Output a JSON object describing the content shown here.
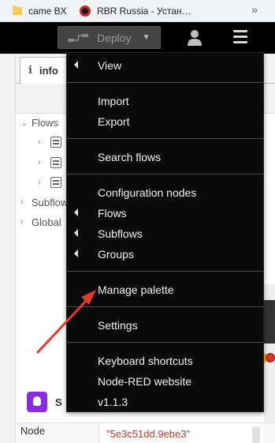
{
  "bookmarks": [
    {
      "label": "came BX",
      "icon": "folder-icon"
    },
    {
      "label": "RBR Russia - Устан…",
      "icon": "rbr-favicon-icon"
    }
  ],
  "bookmarks_more": "»",
  "header": {
    "deploy_label": "Deploy",
    "deploy_caret": "▼"
  },
  "sidebar": {
    "tab_icon": "i",
    "tab_label": "info",
    "tree": {
      "flows": "Flows",
      "subflows": "Subflows",
      "global": "Global"
    },
    "tree_arrows": {
      "expanded": "⌄",
      "collapsed": "›"
    },
    "node_label_short": "S",
    "property": {
      "key": "Node",
      "value": "\"5e3c51dd.9ebe3\""
    }
  },
  "menu": {
    "view": "View",
    "import": "Import",
    "export": "Export",
    "search_flows": "Search flows",
    "configuration_nodes": "Configuration nodes",
    "flows": "Flows",
    "subflows": "Subflows",
    "groups": "Groups",
    "manage_palette": "Manage palette",
    "settings": "Settings",
    "keyboard_shortcuts": "Keyboard shortcuts",
    "node_red_website": "Node-RED website",
    "version": "v1.1.3"
  },
  "colors": {
    "header_bg": "#000000",
    "menu_bg": "#0a0a0a",
    "annotation_arrow": "#e03a2f",
    "node_icon": "#8a2be2"
  }
}
